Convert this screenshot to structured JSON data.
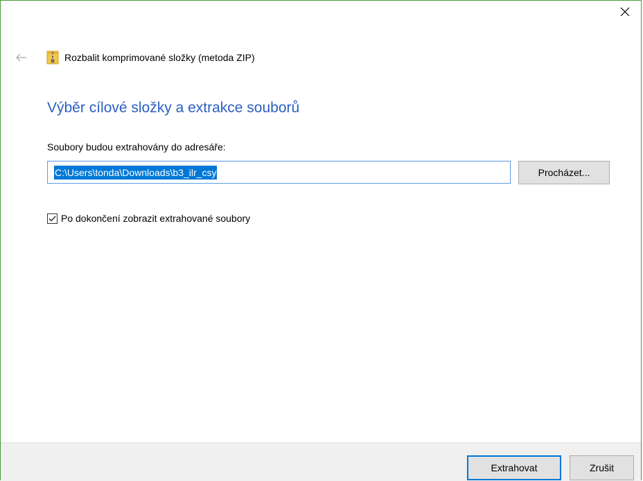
{
  "window": {
    "close_icon": "close-icon",
    "back_icon": "back-arrow-icon",
    "accent_color": "#4a9a3a"
  },
  "header": {
    "icon": "zip-folder-icon",
    "title": "Rozbalit komprimované složky (metoda ZIP)"
  },
  "main": {
    "heading": "Výběr cílové složky a extrakce souborů",
    "heading_color": "#2a5fc0",
    "destination_label": "Soubory budou extrahovány do adresáře:",
    "destination_value": "C:\\Users\\tonda\\Downloads\\b3_ilr_csy",
    "browse_label": "Procházet...",
    "show_files_checked": true,
    "show_files_label": "Po dokončení zobrazit extrahované soubory"
  },
  "footer": {
    "extract_label": "Extrahovat",
    "cancel_label": "Zrušit"
  }
}
